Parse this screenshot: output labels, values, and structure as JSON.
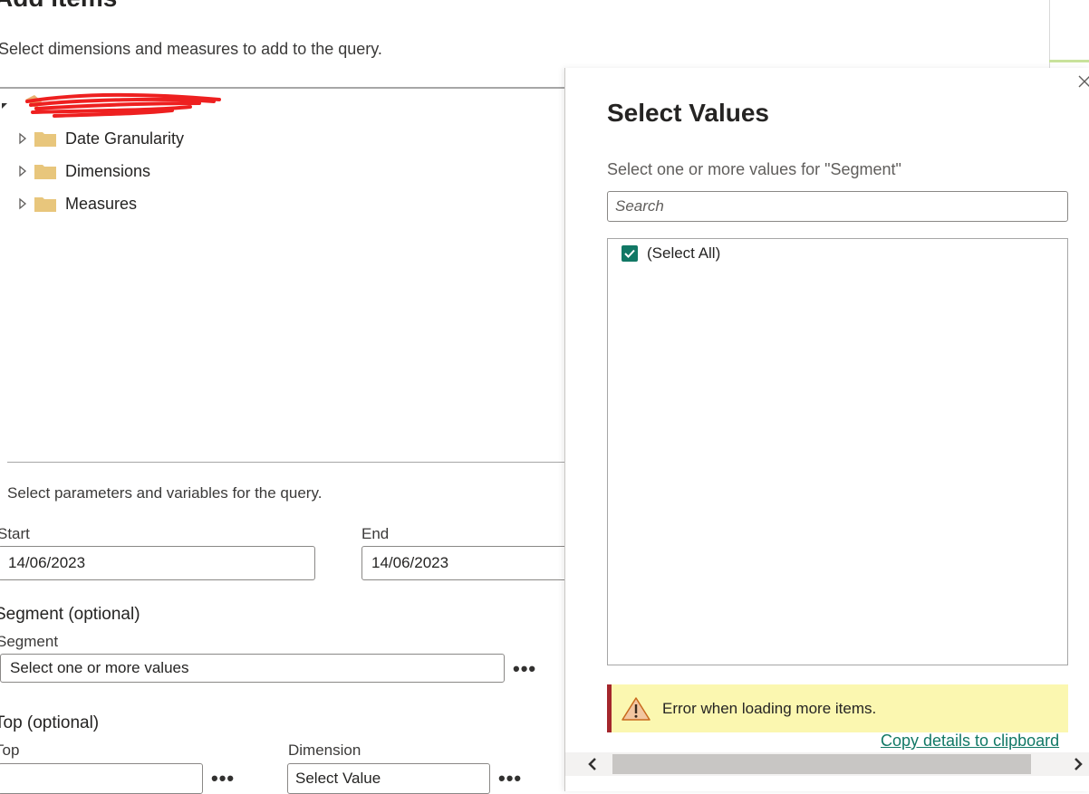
{
  "dialog": {
    "title": "Add items",
    "subtitle": "Select dimensions and measures to add to the query.",
    "tree": [
      {
        "label": "Date Granularity",
        "icon": "folder-icon"
      },
      {
        "label": "Dimensions",
        "icon": "folder-icon"
      },
      {
        "label": "Measures",
        "icon": "folder-icon"
      }
    ],
    "params_subtitle": "Select parameters and variables for the query.",
    "start_label": "Start",
    "start_value": "14/06/2023",
    "end_label": "End",
    "end_value": "14/06/2023",
    "segment_group": "Segment (optional)",
    "segment_label": "Segment",
    "segment_value": "Select one or more values",
    "top_group": "Top (optional)",
    "top_label": "Top",
    "top_value": "",
    "dimension_label": "Dimension",
    "dimension_value": "Select Value",
    "more_label": "•••"
  },
  "flyout": {
    "title": "Select Values",
    "subtitle": "Select one or more values for \"Segment\"",
    "search_placeholder": "Search",
    "select_all_label": "(Select All)",
    "select_all_checked": true,
    "error_text": "Error when loading more items.",
    "copy_link": "Copy details to clipboard"
  },
  "colors": {
    "accent": "#117865",
    "error_bar": "#fbf7b0",
    "error_border": "#a4262c",
    "folder": "#e8c67c"
  }
}
